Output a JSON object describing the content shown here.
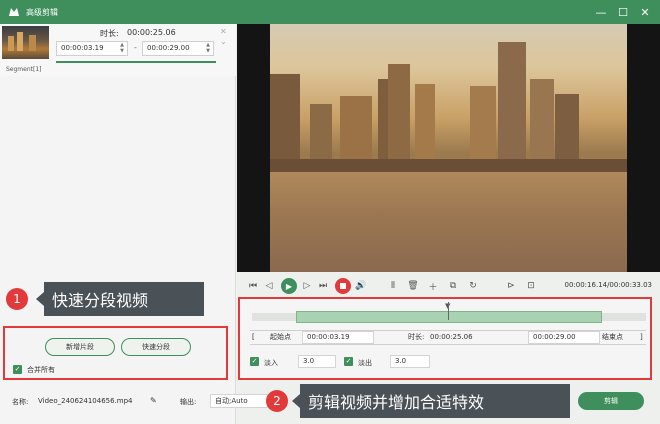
{
  "window": {
    "title": "高级剪辑",
    "minimize": "—",
    "maximize": "☐",
    "close": "✕"
  },
  "segment": {
    "label": "Segment[1]",
    "duration_label": "时长:",
    "duration_value": "00:00:25.06",
    "start": "00:00:03.19",
    "end": "00:00:29.00",
    "separator": "-",
    "progress": 1.0
  },
  "callout1": {
    "number": "1",
    "text": "快速分段视频"
  },
  "callout2": {
    "number": "2",
    "text": "剪辑视频并增加合适特效"
  },
  "buttons": {
    "new_segment": "新增片段",
    "quick_split": "快速分段",
    "merge_all": "合并所有"
  },
  "player": {
    "time_readout": "00:00:16.14/00:00:33.03"
  },
  "timeline": {
    "start_label": "起始点",
    "start_value": "00:00:03.19",
    "duration_label": "时长:",
    "duration_value": "00:00:25.06",
    "end_value": "00:00:29.00",
    "end_label": "结束点",
    "fade_in_label": "淡入",
    "fade_in_value": "3.0",
    "fade_out_label": "淡出",
    "fade_out_value": "3.0"
  },
  "bottom": {
    "name_label": "名称:",
    "file_name": "Video_240624104656.mp4",
    "output_label": "输出:",
    "output_value": "自动;Auto",
    "edit_button": "剪辑"
  },
  "colors": {
    "accent": "#3f8f5c",
    "highlight": "#e23a3a"
  }
}
